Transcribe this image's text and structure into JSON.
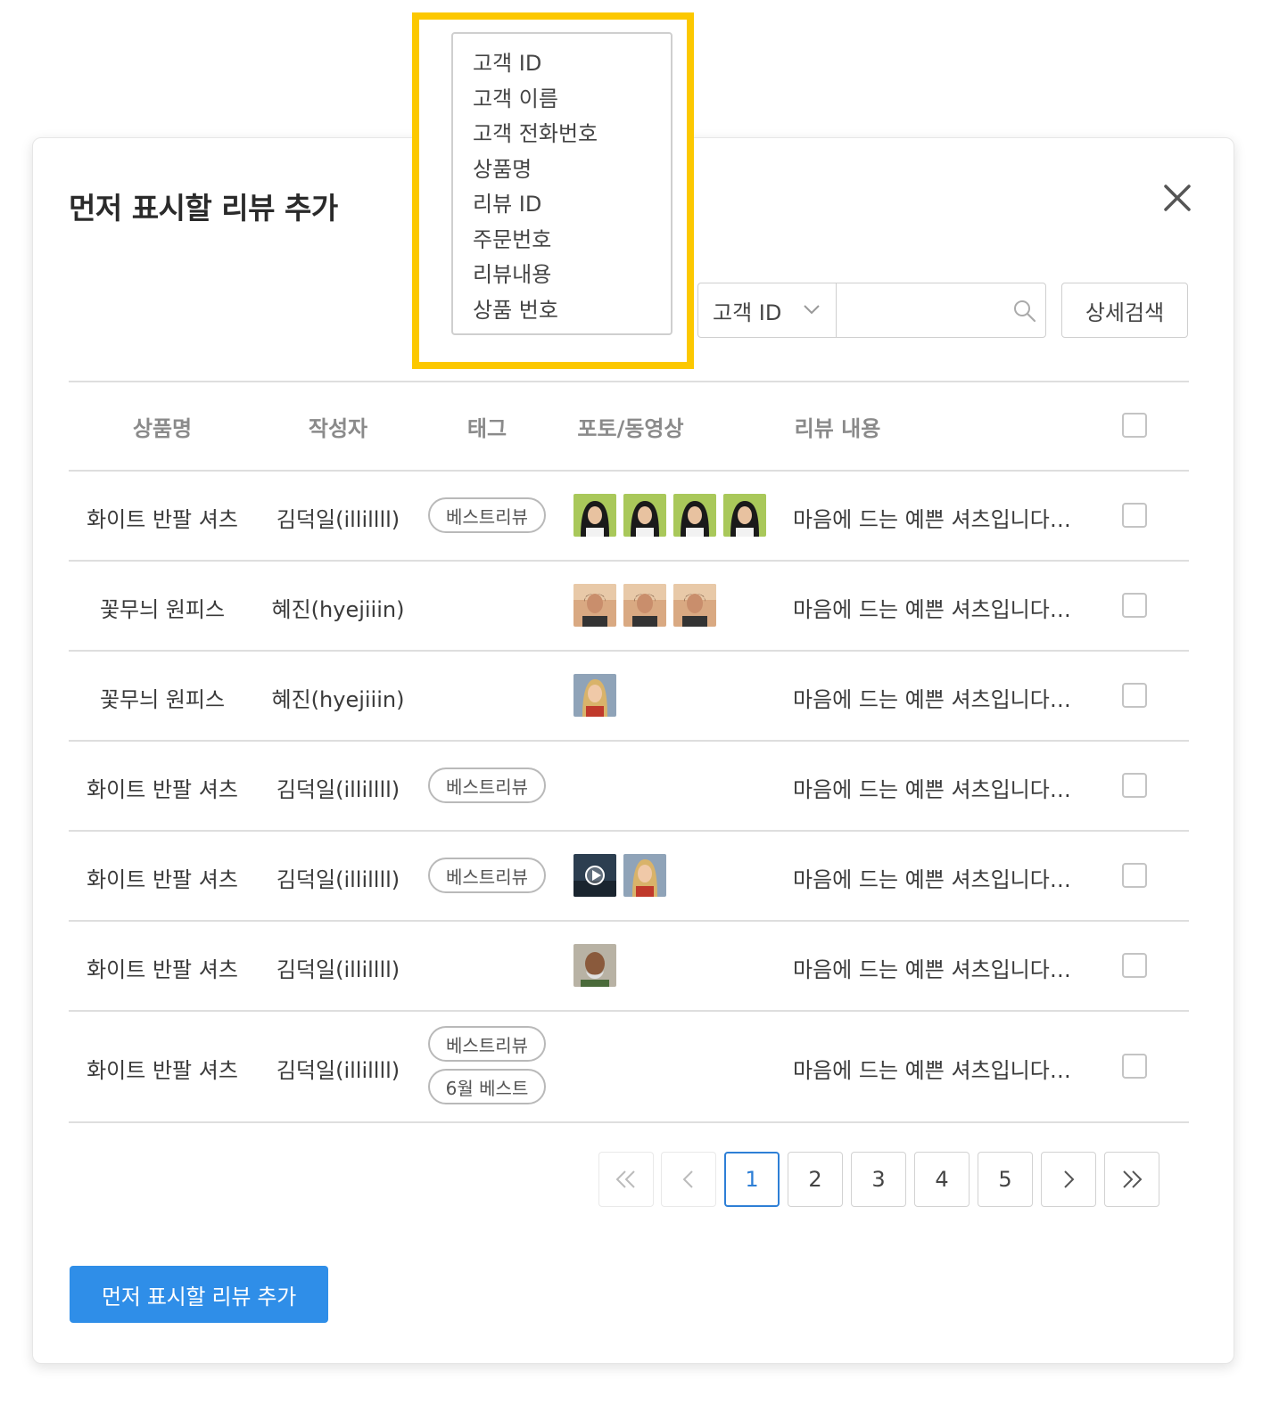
{
  "modal": {
    "title": "먼저 표시할 리뷰 추가",
    "submit_label": "먼저 표시할 리뷰 추가"
  },
  "search": {
    "selected_field": "고객 ID",
    "input_value": "",
    "detail_button": "상세검색"
  },
  "dropdown": {
    "options": [
      "고객 ID",
      "고객 이름",
      "고객 전화번호",
      "상품명",
      "리뷰 ID",
      "주문번호",
      "리뷰내용",
      "상품 번호"
    ]
  },
  "table": {
    "headers": {
      "product": "상품명",
      "author": "작성자",
      "tag": "태그",
      "media": "포토/동영상",
      "content": "리뷰 내용"
    },
    "rows": [
      {
        "product": "화이트 반팔 셔츠",
        "author": "김덕일(illillll)",
        "tags": [
          "베스트리뷰"
        ],
        "content": "마음에 드는 예쁜 셔츠입니다…",
        "media_count": 4
      },
      {
        "product": "꽃무늬 원피스",
        "author": "혜진(hyejiiin)",
        "tags": [],
        "content": "마음에 드는 예쁜 셔츠입니다…",
        "media_count": 3
      },
      {
        "product": "꽃무늬 원피스",
        "author": "혜진(hyejiiin)",
        "tags": [],
        "content": "마음에 드는 예쁜 셔츠입니다…",
        "media_count": 1
      },
      {
        "product": "화이트 반팔 셔츠",
        "author": "김덕일(illillll)",
        "tags": [
          "베스트리뷰"
        ],
        "content": "마음에 드는 예쁜 셔츠입니다…",
        "media_count": 0
      },
      {
        "product": "화이트 반팔 셔츠",
        "author": "김덕일(illillll)",
        "tags": [
          "베스트리뷰"
        ],
        "content": "마음에 드는 예쁜 셔츠입니다…",
        "media_count": 2
      },
      {
        "product": "화이트 반팔 셔츠",
        "author": "김덕일(illillll)",
        "tags": [],
        "content": "마음에 드는 예쁜 셔츠입니다…",
        "media_count": 1
      },
      {
        "product": "화이트 반팔 셔츠",
        "author": "김덕일(illillll)",
        "tags": [
          "베스트리뷰",
          "6월 베스트"
        ],
        "content": "마음에 드는 예쁜 셔츠입니다…",
        "media_count": 0
      }
    ]
  },
  "pagination": {
    "pages": [
      "1",
      "2",
      "3",
      "4",
      "5"
    ],
    "current": "1"
  },
  "colors": {
    "accent": "#2f8ee8",
    "highlight": "#fcc800",
    "active_page": "#2e7fd6"
  }
}
